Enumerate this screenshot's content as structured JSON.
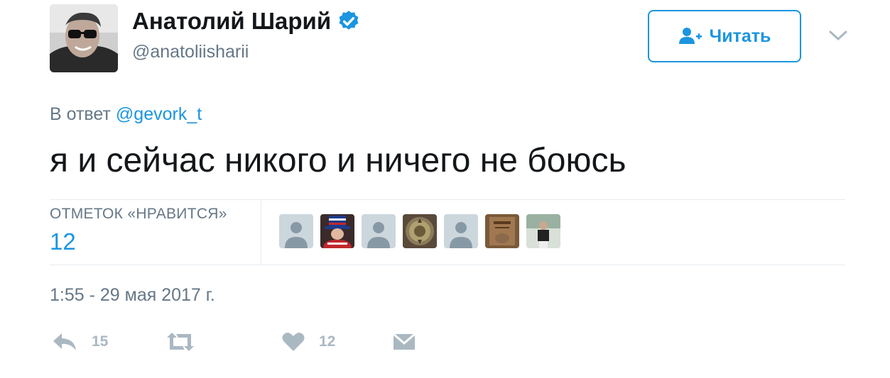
{
  "author": {
    "display_name": "Анатолий Шарий",
    "handle": "@anatoliisharii",
    "verified": true
  },
  "follow_button": {
    "label": "Читать"
  },
  "reply_to": {
    "prefix": "В ответ",
    "mention": "@gevork_t"
  },
  "tweet": {
    "text": "я и сейчас никого и ничего не боюсь"
  },
  "likes": {
    "label": "ОТМЕТОК «НРАВИТСЯ»",
    "count": "12"
  },
  "timestamp": "1:55 - 29 мая 2017 г.",
  "actions": {
    "reply_count": "15",
    "like_count": "12"
  },
  "colors": {
    "accent": "#1b95e0",
    "muted": "#657786",
    "icon": "#aab8c2"
  }
}
